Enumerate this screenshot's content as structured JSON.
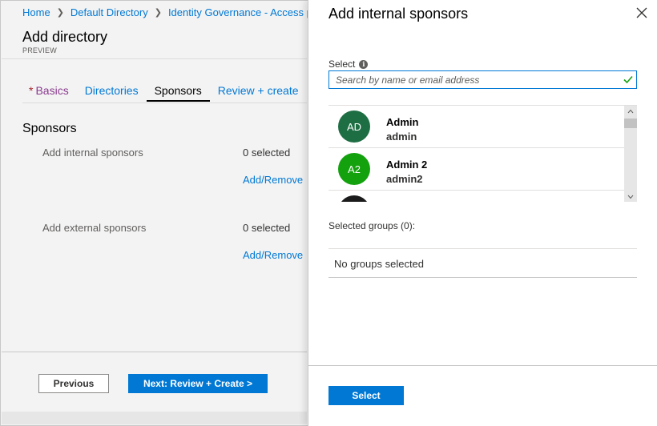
{
  "breadcrumb": {
    "items": [
      "Home",
      "Default Directory",
      "Identity Governance - Access pa"
    ]
  },
  "blade": {
    "title": "Add directory",
    "subtitle": "PREVIEW",
    "tabs": [
      {
        "label": "Basics",
        "required_mark": "*"
      },
      {
        "label": "Directories"
      },
      {
        "label": "Sponsors",
        "active": true
      },
      {
        "label": "Review + create"
      }
    ],
    "section_title": "Sponsors",
    "internal": {
      "label": "Add internal sponsors",
      "value": "0 selected",
      "link": "Add/Remove"
    },
    "external": {
      "label": "Add external sponsors",
      "value": "0 selected",
      "link": "Add/Remove"
    },
    "footer": {
      "previous": "Previous",
      "next": "Next: Review + Create >"
    }
  },
  "panel": {
    "title": "Add internal sponsors",
    "close_icon": "close-icon",
    "select_label": "Select",
    "search_placeholder": "Search by name or email address",
    "users": [
      {
        "initials": "AD",
        "name": "Admin",
        "username": "admin",
        "color": "#1e6e44"
      },
      {
        "initials": "A2",
        "name": "Admin 2",
        "username": "admin2",
        "color": "#13a10e"
      },
      {
        "initials": "",
        "name": "",
        "username": "",
        "color": "#1b1b1b"
      }
    ],
    "selected_groups_label": "Selected groups (0):",
    "no_groups_text": "No groups selected",
    "select_button": "Select"
  },
  "colors": {
    "accent": "#0078d4",
    "valid_check": "#13a10e"
  }
}
